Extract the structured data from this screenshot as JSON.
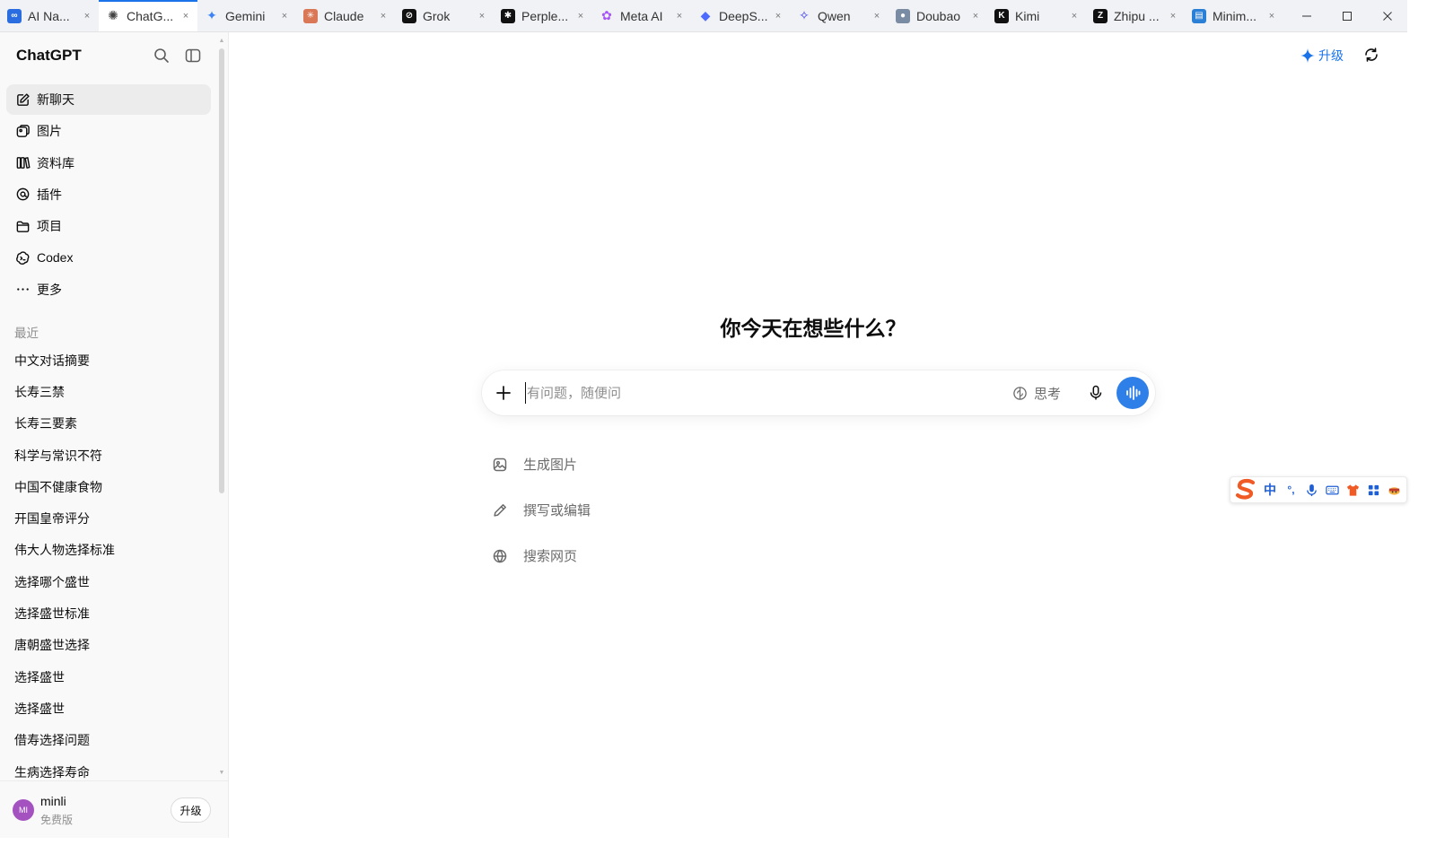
{
  "browser": {
    "tabs": [
      {
        "title": "AI Na...",
        "icon": "infinity-icon",
        "color": "#2a6de0",
        "active": false
      },
      {
        "title": "ChatG...",
        "icon": "openai-icon",
        "color": "#444444",
        "active": true
      },
      {
        "title": "Gemini",
        "icon": "gemini-sparkle-icon",
        "color": "#3b82f6",
        "active": false
      },
      {
        "title": "Claude",
        "icon": "claude-icon",
        "color": "#d97757",
        "active": false
      },
      {
        "title": "Grok",
        "icon": "grok-icon",
        "color": "#111111",
        "active": false
      },
      {
        "title": "Perple...",
        "icon": "perplexity-icon",
        "color": "#111111",
        "active": false
      },
      {
        "title": "Meta AI",
        "icon": "meta-ai-icon",
        "color": "#a855f7",
        "active": false
      },
      {
        "title": "DeepS...",
        "icon": "deepseek-whale-icon",
        "color": "#4d6bfe",
        "active": false
      },
      {
        "title": "Qwen",
        "icon": "qwen-icon",
        "color": "#3b3bf0",
        "active": false
      },
      {
        "title": "Doubao",
        "icon": "doubao-icon",
        "color": "#7a8ca3",
        "active": false
      },
      {
        "title": "Kimi",
        "icon": "kimi-icon",
        "color": "#111111",
        "active": false
      },
      {
        "title": "Zhipu ...",
        "icon": "zhipu-icon",
        "color": "#111111",
        "active": false
      },
      {
        "title": "Minim...",
        "icon": "minimax-icon",
        "color": "#2a7fd6",
        "active": false
      }
    ],
    "close_glyph": "×"
  },
  "sidebar": {
    "brand": "ChatGPT",
    "nav": [
      {
        "label": "新聊天",
        "icon": "edit-icon",
        "active": true
      },
      {
        "label": "图片",
        "icon": "image-icon",
        "active": false
      },
      {
        "label": "资料库",
        "icon": "library-icon",
        "active": false
      },
      {
        "label": "插件",
        "icon": "plugin-icon",
        "active": false
      },
      {
        "label": "项目",
        "icon": "folder-icon",
        "active": false
      },
      {
        "label": "Codex",
        "icon": "codex-icon",
        "active": false
      },
      {
        "label": "更多",
        "icon": "more-icon",
        "active": false
      }
    ],
    "recent_title": "最近",
    "recent": [
      "中文对话摘要",
      "长寿三禁",
      "长寿三要素",
      "科学与常识不符",
      "中国不健康食物",
      "开国皇帝评分",
      "伟大人物选择标准",
      "选择哪个盛世",
      "选择盛世标准",
      "唐朝盛世选择",
      "选择盛世",
      "选择盛世",
      "借寿选择问题",
      "生病选择寿命"
    ],
    "user": {
      "initials": "MI",
      "name": "minli",
      "plan": "免费版",
      "upgrade_label": "升级"
    }
  },
  "main": {
    "upgrade_label": "升级",
    "headline": "你今天在想些什么？",
    "composer": {
      "placeholder": "有问题，随便问",
      "think_label": "思考"
    },
    "suggestions": [
      {
        "label": "生成图片",
        "icon": "image-generate-icon"
      },
      {
        "label": "撰写或编辑",
        "icon": "pencil-icon"
      },
      {
        "label": "搜索网页",
        "icon": "globe-icon"
      }
    ]
  },
  "ime": {
    "mode_label": "中",
    "punct_label": "°,"
  },
  "colors": {
    "accent": "#1a73e8",
    "voice_button": "#2f7fe8",
    "sidebar_bg": "#f9f9f9",
    "avatar": "#a352c0",
    "ime_logo": "#f05a24"
  }
}
